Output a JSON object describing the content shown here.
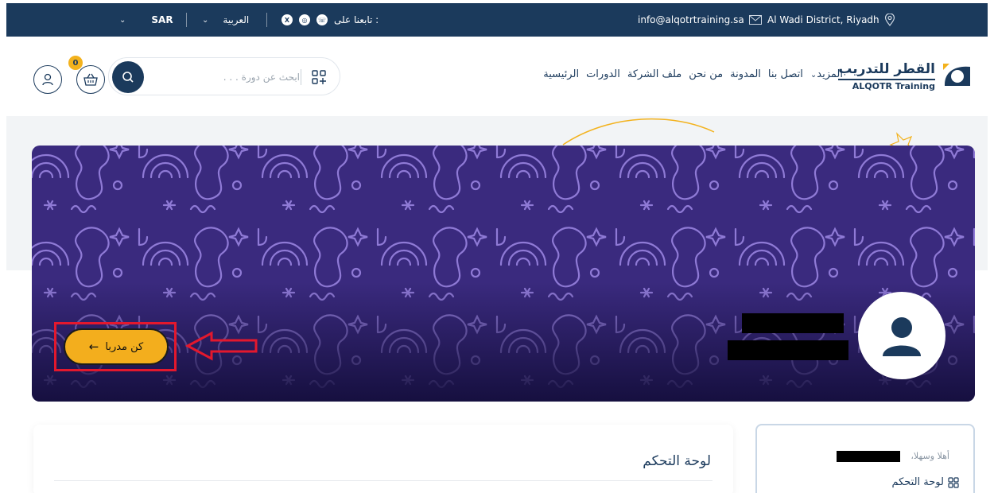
{
  "topbar": {
    "currency": "SAR",
    "language": "العربية",
    "follow_label": "تابعنا على :",
    "email": "info@alqotrtraining.sa",
    "address": "Al Wadi District, Riyadh"
  },
  "logo": {
    "name_ar": "القطر للتدريب",
    "name_en": "ALQOTR Training"
  },
  "nav": {
    "items": [
      "الرئيسية",
      "الدورات",
      "ملف الشركة",
      "من نحن",
      "المدونة",
      "اتصل بنا",
      "المزيد"
    ]
  },
  "search": {
    "placeholder": "ابحث عن دورة . . ."
  },
  "cart": {
    "count": "0"
  },
  "profile": {
    "become_instructor_label": "كن مدربا"
  },
  "main": {
    "title": "لوحة التحكم"
  },
  "sidebar": {
    "greeting": "أهلا وسهلا،",
    "dashboard_label": "لوحة التحكم"
  },
  "colors": {
    "navy": "#1b3a5c",
    "accent": "#f3ae1d",
    "cover_purple": "#3a2a7e",
    "highlight_red": "#e3182d"
  }
}
